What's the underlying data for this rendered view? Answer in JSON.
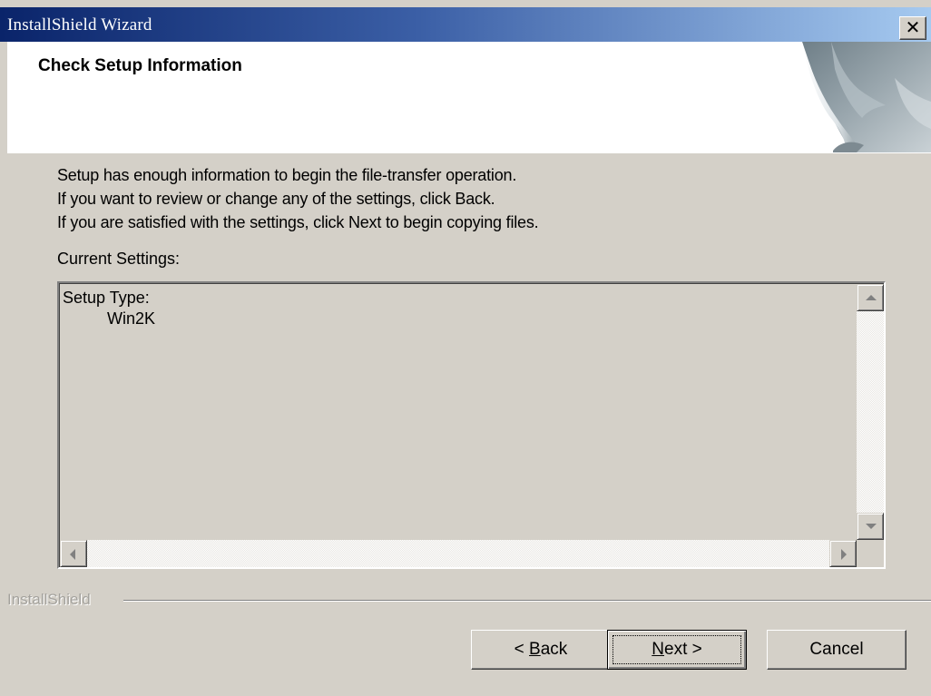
{
  "window": {
    "title": "InstallShield Wizard",
    "close_glyph": "✕"
  },
  "header": {
    "title": "Check Setup Information",
    "graphic": "page-curl-graphic"
  },
  "body": {
    "lines": [
      "Setup has enough information to begin the file-transfer operation.",
      "If you want to review or change any of the settings, click Back.",
      "If you are satisfied with the settings, click Next to begin copying files."
    ],
    "current_settings_label": "Current Settings:"
  },
  "settings": {
    "key": "Setup Type:",
    "value": "Win2K"
  },
  "brand": {
    "label": "InstallShield"
  },
  "buttons": {
    "back": {
      "prefix": "< ",
      "mnemonic": "B",
      "rest": "ack"
    },
    "next": {
      "mnemonic": "N",
      "rest": "ext",
      "suffix": " >"
    },
    "cancel": "Cancel"
  },
  "colors": {
    "title_start": "#0a246a",
    "title_end": "#a6caf0",
    "face": "#d4d0c8"
  }
}
